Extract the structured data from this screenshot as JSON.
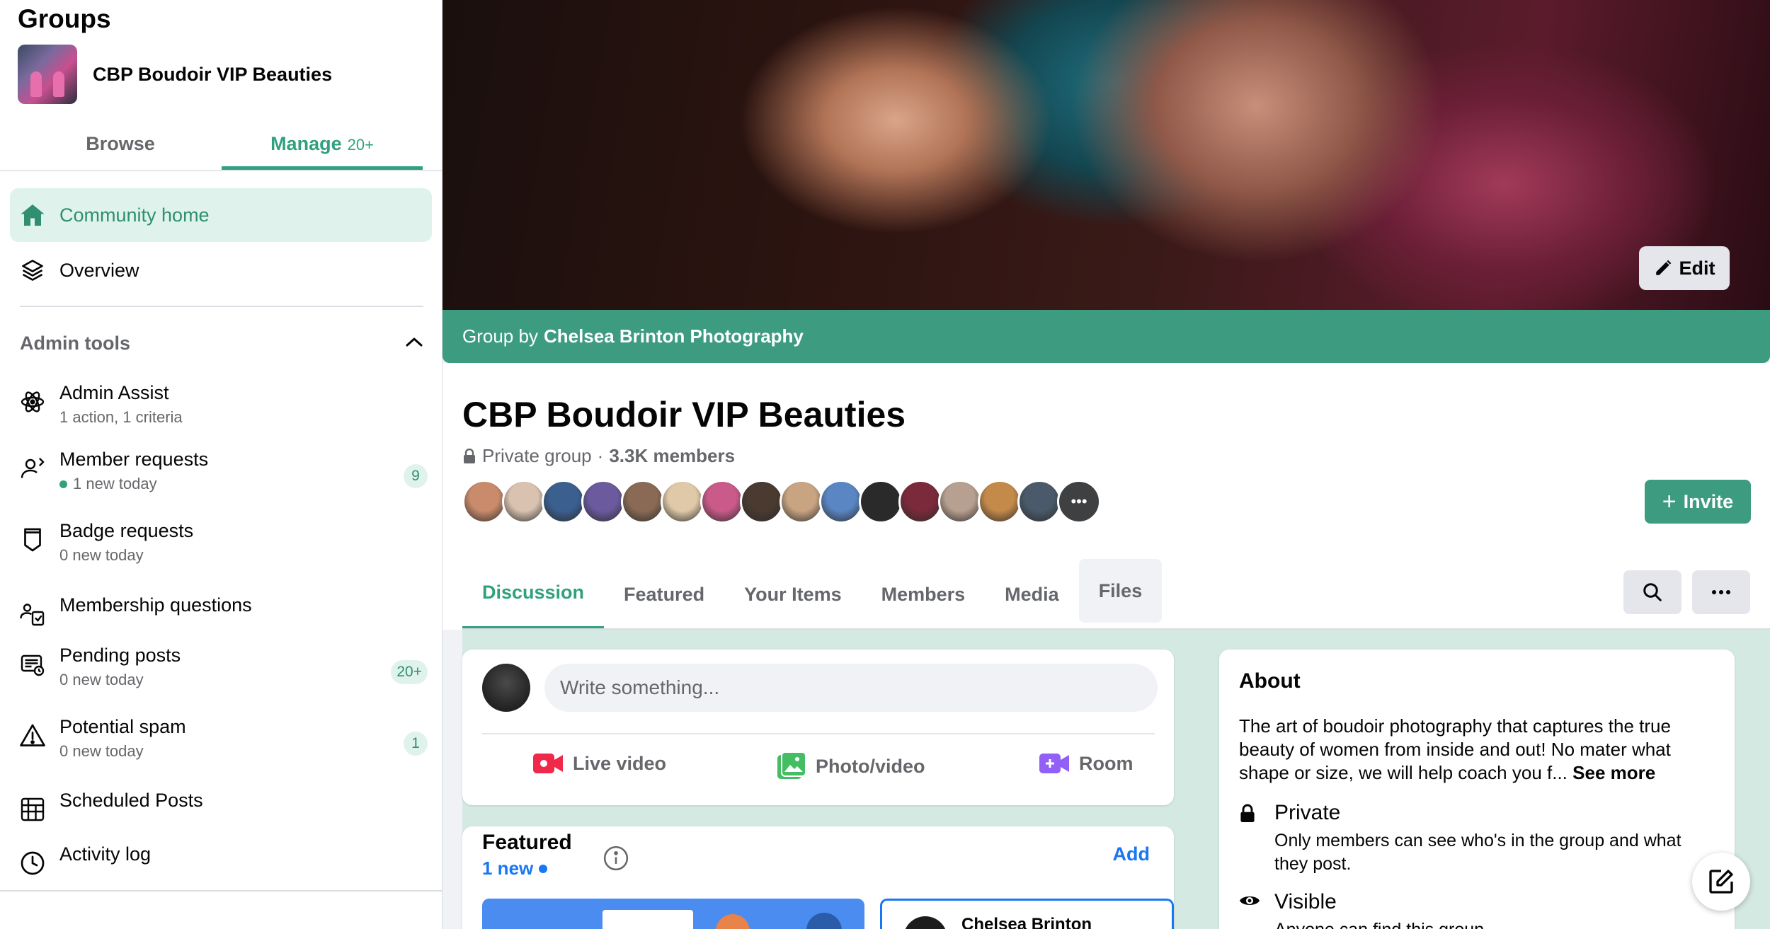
{
  "sidebar": {
    "title": "Groups",
    "group_name": "CBP Boudoir VIP Beauties",
    "tabs": {
      "browse": "Browse",
      "manage": "Manage",
      "manage_count": "20+"
    },
    "nav": [
      {
        "label": "Community home",
        "icon": "home-icon"
      },
      {
        "label": "Overview",
        "icon": "layers-icon"
      }
    ],
    "admin_tools_label": "Admin tools",
    "tools": [
      {
        "title": "Admin Assist",
        "sub": "1 action, 1 criteria",
        "badge": ""
      },
      {
        "title": "Member requests",
        "sub": "1 new today",
        "badge": "9"
      },
      {
        "title": "Badge requests",
        "sub": "0 new today",
        "badge": ""
      },
      {
        "title": "Membership questions",
        "sub": "",
        "badge": ""
      },
      {
        "title": "Pending posts",
        "sub": "0 new today",
        "badge": "20+"
      },
      {
        "title": "Potential spam",
        "sub": "0 new today",
        "badge": "1"
      },
      {
        "title": "Scheduled Posts",
        "sub": "",
        "badge": ""
      },
      {
        "title": "Activity log",
        "sub": "",
        "badge": ""
      }
    ]
  },
  "cover": {
    "edit_label": "Edit"
  },
  "owner_bar": {
    "prefix": "Group by",
    "owner": "Chelsea Brinton Photography"
  },
  "group": {
    "title": "CBP Boudoir VIP Beauties",
    "privacy": "Private group",
    "members": "3.3K members",
    "invite_label": "Invite",
    "avatar_colors": [
      "#c98b6b",
      "#d9c2b0",
      "#3b5f8f",
      "#6b5a9e",
      "#8a6a55",
      "#e0c9a8",
      "#c95a8a",
      "#4a3a30",
      "#c9a482",
      "#5a86c4",
      "#2a2a2a",
      "#7a2a3a",
      "#b8a090",
      "#c48a4a",
      "#4a5a6a"
    ]
  },
  "tabs": [
    "Discussion",
    "Featured",
    "Your Items",
    "Members",
    "Media",
    "Files"
  ],
  "composer": {
    "placeholder": "Write something...",
    "actions": [
      "Live video",
      "Photo/video",
      "Room"
    ]
  },
  "featured": {
    "title": "Featured",
    "new_label": "1 new",
    "add_label": "Add",
    "card_author": "Chelsea Brinton"
  },
  "about": {
    "title": "About",
    "description": "The art of boudoir photography that captures the true beauty of women from inside and out! No mater what shape or size, we will help coach you f...",
    "see_more": "See more",
    "private_title": "Private",
    "private_desc": "Only members can see who's in the group and what they post.",
    "visible_title": "Visible",
    "visible_desc": "Anyone can find this group."
  },
  "colors": {
    "accent": "#31a07e",
    "owner_bar": "#3d9b80",
    "link": "#1877f2"
  }
}
